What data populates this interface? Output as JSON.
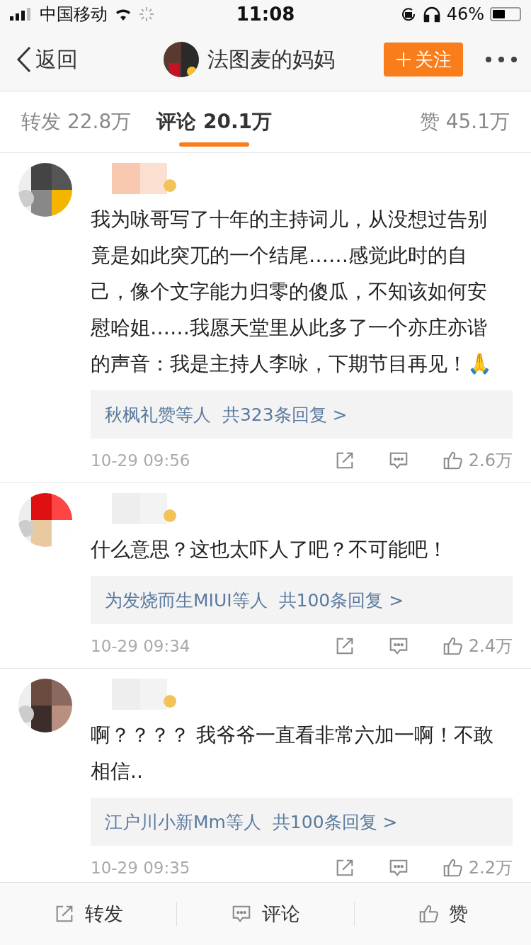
{
  "status_bar": {
    "carrier": "中国移动",
    "time": "11:08",
    "battery": "46%"
  },
  "nav": {
    "back": "返回",
    "title": "法图麦的妈妈",
    "follow": "关注"
  },
  "tabs": [
    {
      "label": "转发",
      "count": "22.8万",
      "selected": false
    },
    {
      "label": "评论",
      "count": "20.1万",
      "selected": true
    },
    {
      "label": "赞",
      "count": "45.1万",
      "selected": false
    }
  ],
  "comments": [
    {
      "text": "我为咏哥写了十年的主持词儿，从没想过告别竟是如此突兀的一个结尾……感觉此时的自己，像个文字能力归零的傻瓜，不知该如何安慰哈姐……我愿天堂里从此多了一个亦庄亦谐的声音：我是主持人李咏，下期节目再见！🙏",
      "replies": "秋枫礼赞等人  共323条回复 >",
      "time": "10-29 09:56",
      "likes": "2.6万"
    },
    {
      "text": "什么意思？这也太吓人了吧？不可能吧！",
      "replies": "为发烧而生MIUI等人  共100条回复 >",
      "time": "10-29 09:34",
      "likes": "2.4万"
    },
    {
      "text": "啊？？？？ 我爷爷一直看非常六加一啊！不敢相信..",
      "replies": "江户川小新Mm等人  共100条回复 >",
      "time": "10-29 09:35",
      "likes": "2.2万"
    }
  ],
  "bottom_bar": [
    {
      "label": "转发",
      "kind": "share"
    },
    {
      "label": "评论",
      "kind": "comment"
    },
    {
      "label": "赞",
      "kind": "like"
    }
  ]
}
